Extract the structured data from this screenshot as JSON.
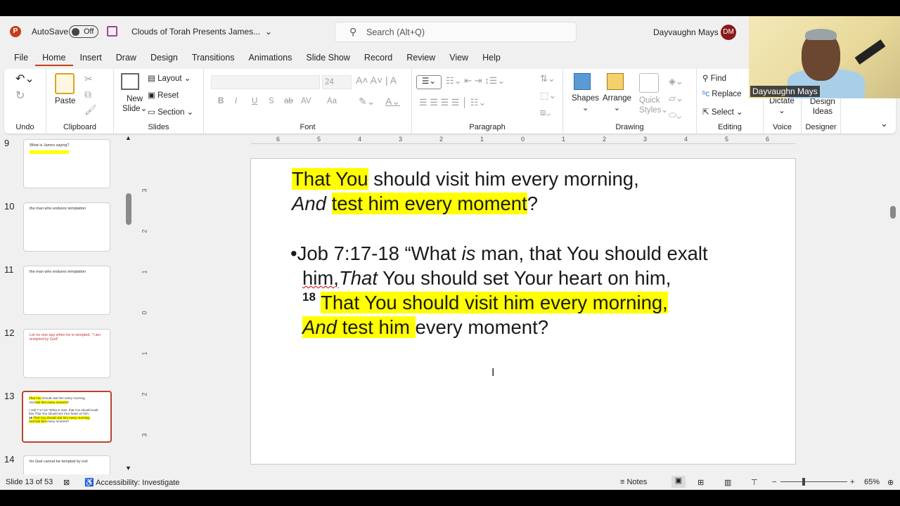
{
  "app": {
    "autosave_label": "AutoSave",
    "autosave_state": "Off",
    "doc_title": "Clouds of Torah Presents James...",
    "search_placeholder": "Search (Alt+Q)",
    "user_name": "Dayvaughn Mays",
    "user_initials": "DM",
    "accent": "#c43e1c"
  },
  "tabs": [
    "File",
    "Home",
    "Insert",
    "Draw",
    "Design",
    "Transitions",
    "Animations",
    "Slide Show",
    "Record",
    "Review",
    "View",
    "Help"
  ],
  "active_tab": "Home",
  "ribbon": {
    "undo": {
      "label": "Undo"
    },
    "clipboard": {
      "label": "Clipboard",
      "paste": "Paste"
    },
    "slides": {
      "label": "Slides",
      "new_slide_1": "New",
      "new_slide_2": "Slide",
      "layout": "Layout",
      "reset": "Reset",
      "section": "Section"
    },
    "font": {
      "label": "Font",
      "size": "24",
      "bold": "B",
      "italic": "I",
      "underline": "U",
      "shadow": "S",
      "strike": "ab",
      "spacing": "AV",
      "case": "Aa"
    },
    "paragraph": {
      "label": "Paragraph"
    },
    "drawing": {
      "label": "Drawing",
      "shapes": "Shapes",
      "arrange": "Arrange",
      "quick_styles_1": "Quick",
      "quick_styles_2": "Styles"
    },
    "editing": {
      "label": "Editing",
      "find": "Find",
      "replace": "Replace",
      "select": "Select"
    },
    "voice": {
      "label": "Voice",
      "dictate": "Dictate"
    },
    "designer": {
      "label": "Designer",
      "design_ideas_1": "Design",
      "design_ideas_2": "Ideas"
    }
  },
  "webcam": {
    "name": "Dayvaughn Mays"
  },
  "thumbnails": [
    {
      "num": "9",
      "title": "What is James saying?"
    },
    {
      "num": "10",
      "title": "the man who endures temptation"
    },
    {
      "num": "11",
      "title": "the man who endures temptation"
    },
    {
      "num": "12",
      "title": "Let no one say when he is tempted, \"I am tempted by God\""
    },
    {
      "num": "13",
      "title": ""
    },
    {
      "num": "14",
      "title": "for God cannot be tempted by evil"
    }
  ],
  "slide": {
    "l1a": "That You",
    "l1b": " should visit him every morning,",
    "l2a": "And",
    "l2b": "test him every moment",
    "l2c": "?",
    "bullet": "•",
    "l3a": "Job 7:17-18  “What ",
    "l3b": "is",
    "l3c": " man, that You should exalt",
    "l4a": "him,",
    "l4b": "That",
    "l4c": " You should set Your heart on him,",
    "l5sup": "18",
    "l5": "That You should visit him every morning,",
    "l6a": "And",
    "l6b": " test him ",
    "l6c": "every moment?"
  },
  "ruler": {
    "h": [
      "6",
      "5",
      "4",
      "3",
      "2",
      "1",
      "0",
      "1",
      "2",
      "3",
      "4",
      "5",
      "6"
    ],
    "v": [
      "3",
      "2",
      "1",
      "0",
      "1",
      "2",
      "3"
    ]
  },
  "status": {
    "slide_info": "Slide 13 of 53",
    "accessibility": "Accessibility: Investigate",
    "notes": "Notes",
    "zoom": "65%",
    "zoom_level": 65
  }
}
